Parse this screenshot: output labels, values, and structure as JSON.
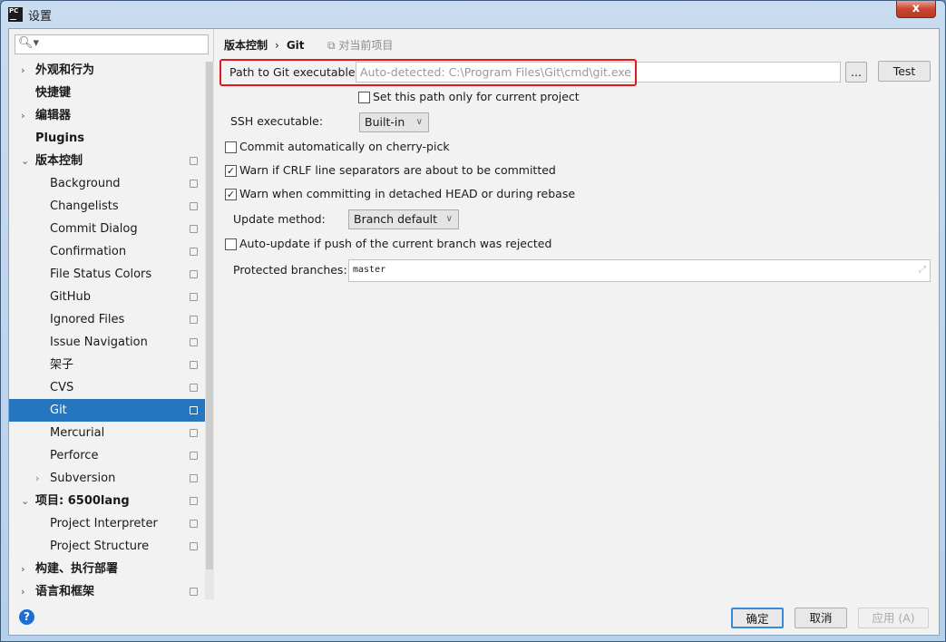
{
  "window": {
    "title": "设置",
    "app_icon": "PC",
    "close_label": "x"
  },
  "sidebar": {
    "search_placeholder": "",
    "items": [
      {
        "label": "外观和行为",
        "arrow": "›",
        "bold": true
      },
      {
        "label": "快捷键",
        "bold": true
      },
      {
        "label": "编辑器",
        "arrow": "›",
        "bold": true
      },
      {
        "label": "Plugins",
        "bold": true
      },
      {
        "label": "版本控制",
        "arrow": "⌄",
        "bold": true,
        "copy": true
      },
      {
        "label": "Background",
        "copy": true,
        "child": true
      },
      {
        "label": "Changelists",
        "copy": true,
        "child": true
      },
      {
        "label": "Commit Dialog",
        "copy": true,
        "child": true
      },
      {
        "label": "Confirmation",
        "copy": true,
        "child": true
      },
      {
        "label": "File Status Colors",
        "copy": true,
        "child": true
      },
      {
        "label": "GitHub",
        "copy": true,
        "child": true
      },
      {
        "label": "Ignored Files",
        "copy": true,
        "child": true
      },
      {
        "label": "Issue Navigation",
        "copy": true,
        "child": true
      },
      {
        "label": "架子",
        "copy": true,
        "child": true
      },
      {
        "label": "CVS",
        "copy": true,
        "child": true
      },
      {
        "label": "Git",
        "copy": true,
        "child": true,
        "selected": true
      },
      {
        "label": "Mercurial",
        "copy": true,
        "child": true
      },
      {
        "label": "Perforce",
        "copy": true,
        "child": true
      },
      {
        "label": "Subversion",
        "copy": true,
        "child": true,
        "arrow": "›"
      },
      {
        "label": "项目: 6500lang",
        "arrow": "⌄",
        "bold": true,
        "copy": true
      },
      {
        "label": "Project Interpreter",
        "copy": true,
        "child": true
      },
      {
        "label": "Project Structure",
        "copy": true,
        "child": true
      },
      {
        "label": "构建、执行部署",
        "arrow": "›",
        "bold": true
      },
      {
        "label": "语言和框架",
        "arrow": "›",
        "bold": true,
        "copy": true
      }
    ]
  },
  "main": {
    "breadcrumb": {
      "parent": "版本控制",
      "sep": "›",
      "current": "Git",
      "project_scope": "对当前项目"
    },
    "git_path": {
      "label": "Path to Git executable:",
      "placeholder": "Auto-detected: C:\\Program Files\\Git\\cmd\\git.exe",
      "browse": "...",
      "test": "Test"
    },
    "project_only": {
      "label": "Set this path only for current project",
      "checked": false
    },
    "ssh": {
      "label": "SSH executable:",
      "value": "Built-in"
    },
    "cherry_pick": {
      "label": "Commit automatically on cherry-pick",
      "checked": false
    },
    "crlf": {
      "label": "Warn if CRLF line separators are about to be committed",
      "checked": true
    },
    "detached": {
      "label": "Warn when committing in detached HEAD or during rebase",
      "checked": true
    },
    "update_method": {
      "label": "Update method:",
      "value": "Branch default"
    },
    "auto_update": {
      "label": "Auto-update if push of the current branch was rejected",
      "checked": false
    },
    "protected": {
      "label": "Protected branches:",
      "value": "master"
    }
  },
  "footer": {
    "ok": "确定",
    "cancel": "取消",
    "apply": "应用 (A)",
    "help": "?"
  },
  "colors": {
    "selection": "#2675bf",
    "highlight_box": "#e0191b"
  }
}
